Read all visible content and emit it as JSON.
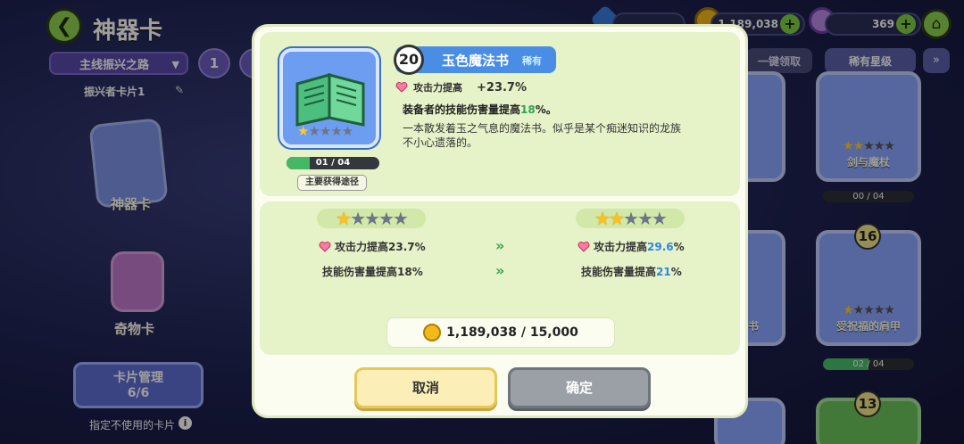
{
  "screen": {
    "title": "神器卡",
    "route_select": "主线振兴之路",
    "page_number": "1",
    "deck_name": "振兴者卡片1",
    "sidebar": {
      "artifact_tab": "神器卡",
      "curio_tab": "奇物卡"
    },
    "card_manage": {
      "label": "卡片管理",
      "count": "6/6"
    },
    "unused_cards_label": "指定不使用的卡片",
    "coins": "1,189,038",
    "gems": "369",
    "claim_all": "一键领取",
    "rare_stars": "稀有星级"
  },
  "bg_cards": [
    {
      "name": "剑与魔杖",
      "stars_on": 2,
      "progress": "00 / 04"
    },
    {
      "name": "受祝福的肩甲",
      "level": "16",
      "stars_on": 1,
      "progress": "02 / 04"
    },
    {
      "level": "13"
    }
  ],
  "bg_partial": {
    "book_suffix": "书"
  },
  "modal": {
    "level": "20",
    "name": "玉色魔法书",
    "rarity": "稀有",
    "atk_label": "攻击力提高",
    "atk_value": "+23.7%",
    "effect_prefix": "装备者的技能伤害量提高",
    "effect_value": "18",
    "effect_suffix": "%。",
    "desc_line1": "一本散发着玉之气息的魔法书。似乎是某个痴迷知识的龙族",
    "desc_line2": "不小心遗落的。",
    "current_stars": 1,
    "progress_text": "01 / 04",
    "progress_fraction": 0.25,
    "source_button": "主要获得途径",
    "upgrade": {
      "from_stars": 1,
      "to_stars": 2,
      "from_atk": "攻击力提高23.7%",
      "to_atk_prefix": "攻击力提高",
      "to_atk_value": "29.6",
      "to_atk_suffix": "%",
      "from_skill": "技能伤害量提高18%",
      "to_skill_prefix": "技能伤害量提高",
      "to_skill_value": "21",
      "to_skill_suffix": "%"
    },
    "cost": "1,189,038 / 15,000",
    "cancel_label": "取消",
    "confirm_label": "确定"
  }
}
